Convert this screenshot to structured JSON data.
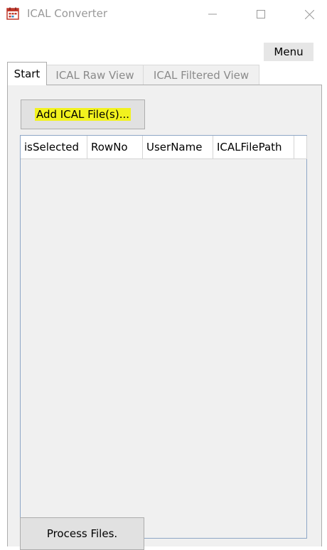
{
  "window": {
    "title": "ICAL Converter",
    "icons": {
      "app": "calendar-icon",
      "minimize": "minimize-icon",
      "maximize": "maximize-icon",
      "close": "close-icon"
    }
  },
  "menu": {
    "label": "Menu"
  },
  "tabs": [
    {
      "label": "Start",
      "active": true
    },
    {
      "label": "ICAL Raw View",
      "active": false
    },
    {
      "label": "ICAL Filtered View",
      "active": false
    }
  ],
  "start": {
    "add_button_label": "Add ICAL File(s)...",
    "process_button_label": "Process Files.",
    "grid": {
      "columns": [
        "isSelected",
        "RowNo",
        "UserName",
        "ICALFilePath"
      ],
      "rows": []
    }
  },
  "colors": {
    "highlight": "#f2f21e",
    "tab_border": "#acacac",
    "panel_bg": "#f0f0f0",
    "grid_border": "#8ea6c6",
    "icon_red": "#c0392b"
  }
}
